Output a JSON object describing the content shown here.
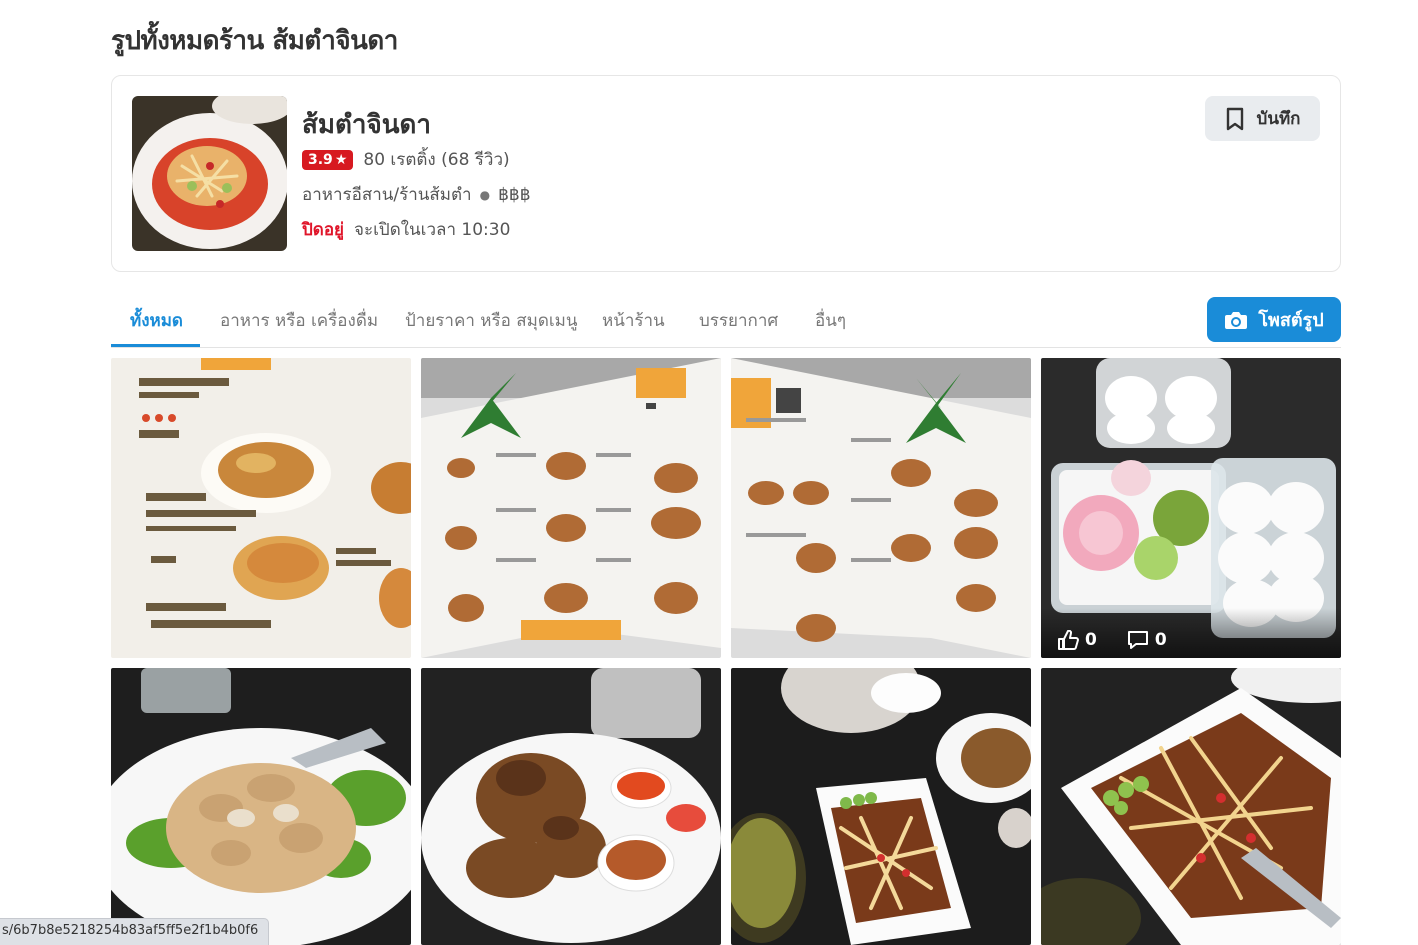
{
  "page": {
    "title": "รูปทั้งหมดร้าน ส้มตำจินดา"
  },
  "restaurant": {
    "name": "ส้มตำจินดา",
    "rating": "3.9",
    "ratings_summary": "80 เรตติ้ง (68 รีวิว)",
    "category": "อาหารอีสาน/ร้านส้มตำ",
    "price": "฿฿฿",
    "status": "ปิดอยู่",
    "opens_at": "จะเปิดในเวลา 10:30",
    "save_label": "บันทึก",
    "rating_color": "#d71920",
    "closed_color": "#e0152a"
  },
  "tabs": [
    {
      "label": "ทั้งหมด",
      "active": true
    },
    {
      "label": "อาหาร หรือ เครื่องดื่ม"
    },
    {
      "label": "ป้ายราคา หรือ สมุดเมนู"
    },
    {
      "label": "หน้าร้าน"
    },
    {
      "label": "บรรยากาศ"
    },
    {
      "label": "อื่นๆ"
    }
  ],
  "post_button": {
    "label": "โพสต์รูป",
    "icon": "camera-icon",
    "color": "#1a8cd8"
  },
  "photos": [
    {
      "subject": "menu-page-somtum"
    },
    {
      "subject": "menu-board"
    },
    {
      "subject": "menu-board"
    },
    {
      "subject": "dessert-boxes",
      "likes": "0",
      "comments": "0"
    },
    {
      "subject": "stir-fried-dish"
    },
    {
      "subject": "grilled-chicken"
    },
    {
      "subject": "papaya-salad-table"
    },
    {
      "subject": "papaya-salad-plate"
    }
  ],
  "status_bar": {
    "url": "s/6b7b8e5218254b83af5ff5e2f1b4b0f6"
  }
}
